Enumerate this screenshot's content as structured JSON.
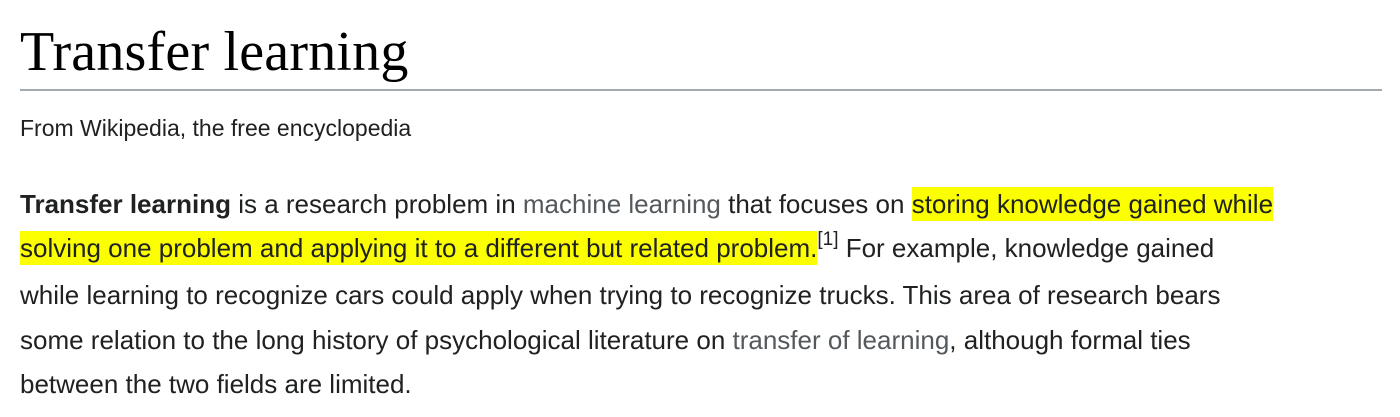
{
  "article": {
    "title": "Transfer learning",
    "tagline": "From Wikipedia, the free encyclopedia"
  },
  "paragraph": {
    "line1": {
      "bold_term": "Transfer learning",
      "text_a": " is a research problem in ",
      "link_machine_learning": "machine learning",
      "text_b": " that focuses on ",
      "highlight_a": "storing knowledge gained while"
    },
    "line2": {
      "highlight_b": "solving one problem and applying it to a different but related problem.",
      "citation": "[1]",
      "text_c": " For example, knowledge gained"
    },
    "line3": {
      "text": "while learning to recognize cars could apply when trying to recognize trucks. This area of research bears"
    },
    "line4": {
      "text_a": "some relation to the long history of psychological literature on ",
      "link_transfer_of_learning": "transfer of learning",
      "text_b": ", although formal ties"
    },
    "line5": {
      "text": "between the two fields are limited."
    }
  },
  "colors": {
    "highlight": "#fbff00",
    "link": "#54595d",
    "rule": "#a2a9b1",
    "text": "#202122"
  }
}
